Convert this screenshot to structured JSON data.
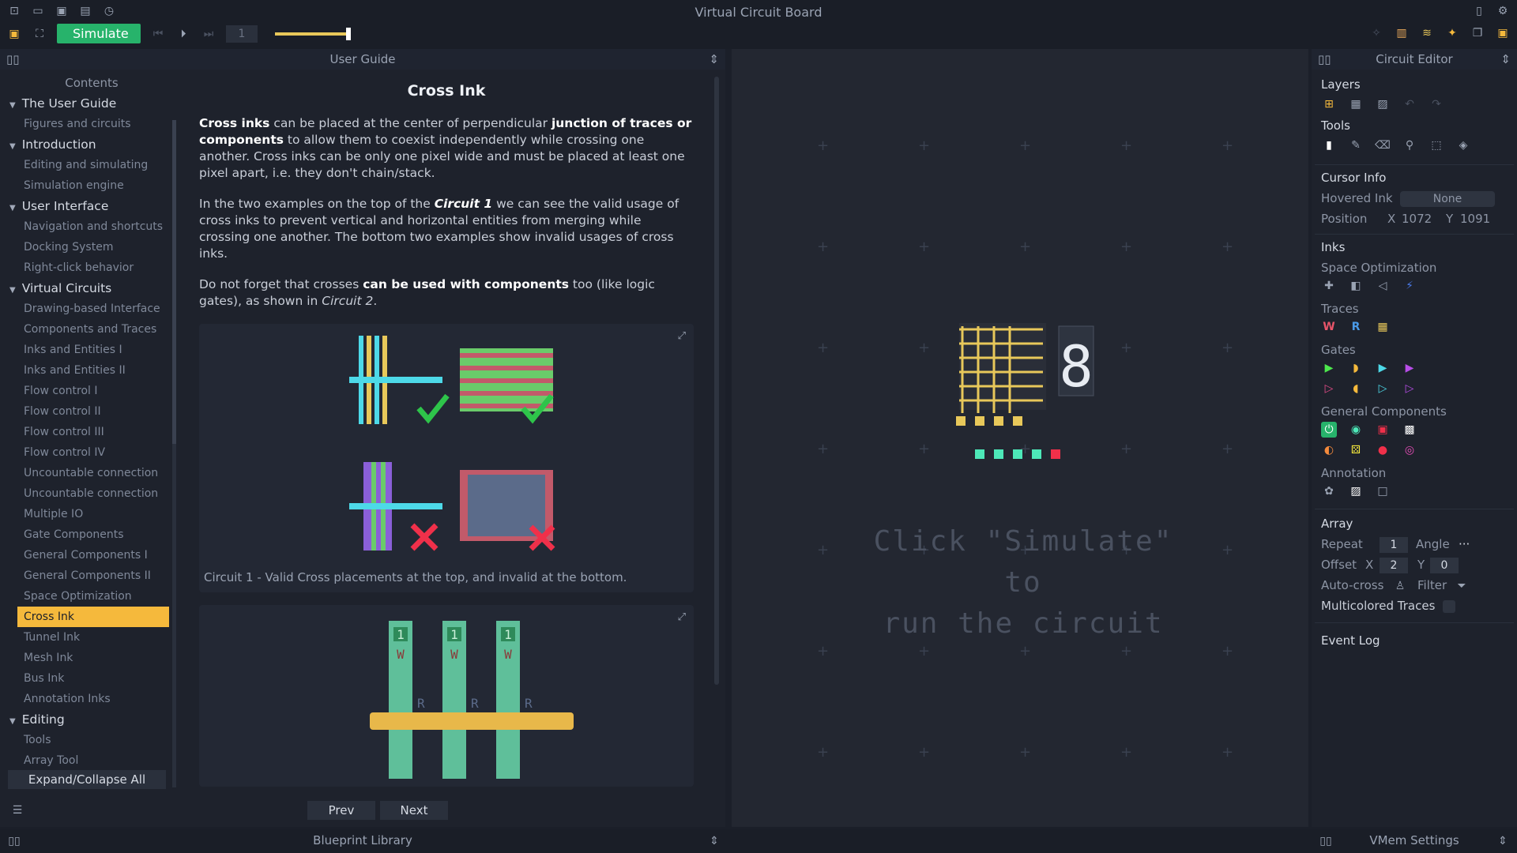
{
  "window": {
    "title": "Virtual Circuit Board"
  },
  "toolbar": {
    "simulate_label": "Simulate",
    "step_value": "1",
    "speed_fraction": 0.85
  },
  "guide": {
    "header": "User Guide",
    "toc_title": "Contents",
    "toc": [
      {
        "label": "The User Guide",
        "type": "section"
      },
      {
        "label": "Figures and circuits",
        "type": "item"
      },
      {
        "label": "Introduction",
        "type": "section"
      },
      {
        "label": "Editing and simulating",
        "type": "item"
      },
      {
        "label": "Simulation engine",
        "type": "item"
      },
      {
        "label": "User Interface",
        "type": "section"
      },
      {
        "label": "Navigation and shortcuts",
        "type": "item"
      },
      {
        "label": "Docking System",
        "type": "item"
      },
      {
        "label": "Right-click behavior",
        "type": "item"
      },
      {
        "label": "Virtual Circuits",
        "type": "section"
      },
      {
        "label": "Drawing-based Interface",
        "type": "item"
      },
      {
        "label": "Components and Traces",
        "type": "item"
      },
      {
        "label": "Inks and Entities I",
        "type": "item"
      },
      {
        "label": "Inks and Entities II",
        "type": "item"
      },
      {
        "label": "Flow control I",
        "type": "item"
      },
      {
        "label": "Flow control II",
        "type": "item"
      },
      {
        "label": "Flow control III",
        "type": "item"
      },
      {
        "label": "Flow control IV",
        "type": "item"
      },
      {
        "label": "Uncountable connection",
        "type": "item"
      },
      {
        "label": "Uncountable connection",
        "type": "item"
      },
      {
        "label": "Multiple IO",
        "type": "item"
      },
      {
        "label": "Gate Components",
        "type": "item"
      },
      {
        "label": "General Components I",
        "type": "item"
      },
      {
        "label": "General Components II",
        "type": "item"
      },
      {
        "label": "Space Optimization",
        "type": "item"
      },
      {
        "label": "Cross Ink",
        "type": "selected"
      },
      {
        "label": "Tunnel Ink",
        "type": "item"
      },
      {
        "label": "Mesh Ink",
        "type": "item"
      },
      {
        "label": "Bus Ink",
        "type": "item"
      },
      {
        "label": "Annotation Inks",
        "type": "item"
      },
      {
        "label": "Editing",
        "type": "section"
      },
      {
        "label": "Tools",
        "type": "item"
      },
      {
        "label": "Array Tool",
        "type": "item"
      }
    ],
    "expand_label": "Expand/Collapse All",
    "article": {
      "title": "Cross Ink",
      "p1_a": "Cross inks",
      "p1_b": " can be placed at the center of perpendicular ",
      "p1_c": "junction of traces or components",
      "p1_d": " to allow them to coexist independently while crossing one another. Cross inks can be only one pixel wide and must be placed at least one pixel apart, i.e. they don't chain/stack.",
      "p2_a": "In the two examples on the top of the ",
      "p2_b": "Circuit 1",
      "p2_c": " we can see the valid usage of cross inks to prevent vertical and horizontal entities from merging while crossing one another. The bottom two examples show invalid usages of cross inks.",
      "p3_a": "Do not forget that crosses ",
      "p3_b": "can be used with components",
      "p3_c": " too (like logic gates), as shown in ",
      "p3_d": "Circuit 2",
      "p3_e": ".",
      "fig1_caption": "Circuit 1 - Valid Cross placements at the top, and invalid at the bottom.",
      "fig2_labels": {
        "one": "1",
        "w": "W",
        "r": "R"
      }
    },
    "prev_label": "Prev",
    "next_label": "Next"
  },
  "canvas": {
    "message_line1": "Click \"Simulate\" to",
    "message_line2": "run the circuit",
    "seg_digit": "8"
  },
  "editor": {
    "header": "Circuit Editor",
    "layers": "Layers",
    "tools": "Tools",
    "cursor_info": "Cursor Info",
    "hovered_ink_label": "Hovered Ink",
    "hovered_ink_value": "None",
    "position_label": "Position",
    "pos_x_label": "X",
    "pos_x": "1072",
    "pos_y_label": "Y",
    "pos_y": "1091",
    "inks": "Inks",
    "space_opt": "Space Optimization",
    "traces": "Traces",
    "trace_w": "W",
    "trace_r": "R",
    "gates": "Gates",
    "general": "General Components",
    "annotation": "Annotation",
    "array": "Array",
    "repeat_label": "Repeat",
    "repeat": "1",
    "angle_label": "Angle",
    "angle_value": "···",
    "offset_label": "Offset",
    "offset_x_label": "X",
    "offset_x": "2",
    "offset_y_label": "Y",
    "offset_y": "0",
    "autocross": "Auto-cross",
    "filter": "Filter",
    "multicolored": "Multicolored Traces",
    "event_log": "Event Log"
  },
  "bottom": {
    "blueprint": "Blueprint Library",
    "vmem": "VMem Settings"
  },
  "colors": {
    "accent": "#f5b93c",
    "simulate": "#27b36b",
    "trace_yellow": "#e8c85a",
    "trace_cyan": "#4dd9e8",
    "trace_red": "#e8556a",
    "trace_green": "#6acb6a"
  }
}
